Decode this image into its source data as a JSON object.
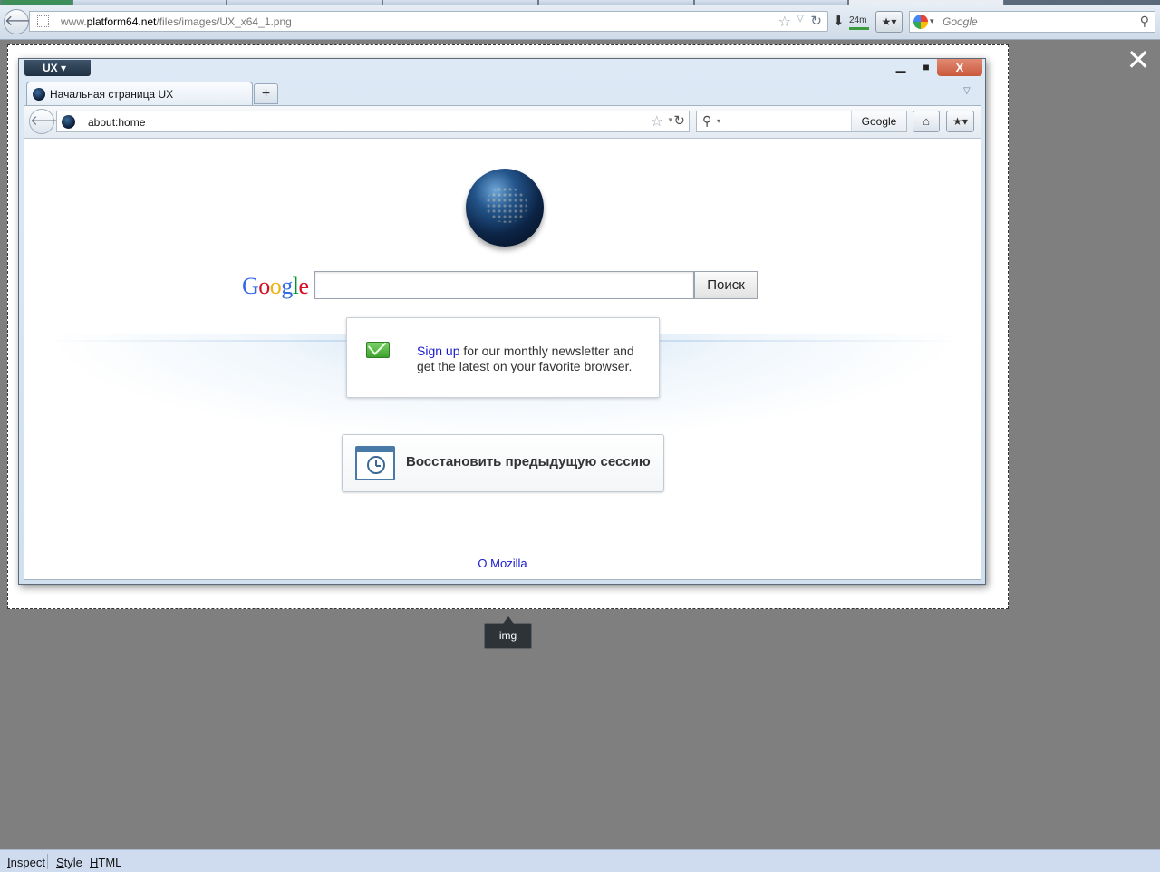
{
  "browser": {
    "back_glyph": "🡐",
    "url_host": "www.platform64.net",
    "url_path": "/files/images/UX_x64_1.png",
    "url_prefix": "www.",
    "url_domain": "platform64.net",
    "star_glyph": "☆",
    "drop_glyph": "▽",
    "reload_glyph": "↻",
    "download_glyph": "⬇",
    "download_time": "24m",
    "download_progress": 1.0,
    "bookmarks_glyph": "★▾",
    "search_engine_drop": "▾",
    "search_placeholder": "Google",
    "search_glyph": "⚲"
  },
  "overlay": {
    "close_glyph": "✕"
  },
  "inner": {
    "menu_label": "UX ▾",
    "min_glyph": "▁",
    "max_glyph": "■",
    "close_glyph": "X",
    "tab_title": "Начальная страница UX",
    "new_tab_glyph": "+",
    "tab_list_glyph": "▽",
    "back_glyph": "🡐",
    "url": "about:home",
    "star_glyph": "☆",
    "drop_glyph": "▾",
    "reload_glyph": "↻",
    "search_glyph": "⚲",
    "search_drop": "▾",
    "search_engine": "Google",
    "home_glyph": "⌂",
    "bookmarks_glyph": "★▾"
  },
  "home": {
    "google_letters": [
      "G",
      "o",
      "o",
      "g",
      "l",
      "e"
    ],
    "search_button": "Поиск",
    "snippet_link": "Sign up",
    "snippet_text": " for our monthly newsletter and get the latest on your favorite browser.",
    "restore_label": "Восстановить предыдущую сессию",
    "about_link": "О Mozilla"
  },
  "inspector": {
    "node_tooltip": "img",
    "buttons": [
      "Inspect",
      "Style",
      "HTML"
    ]
  },
  "colors": {
    "page_background": "#7f7f7f",
    "link_blue": "#1919d0",
    "close_red": "#c9583c",
    "inspector_bar": "#cfdcef"
  }
}
